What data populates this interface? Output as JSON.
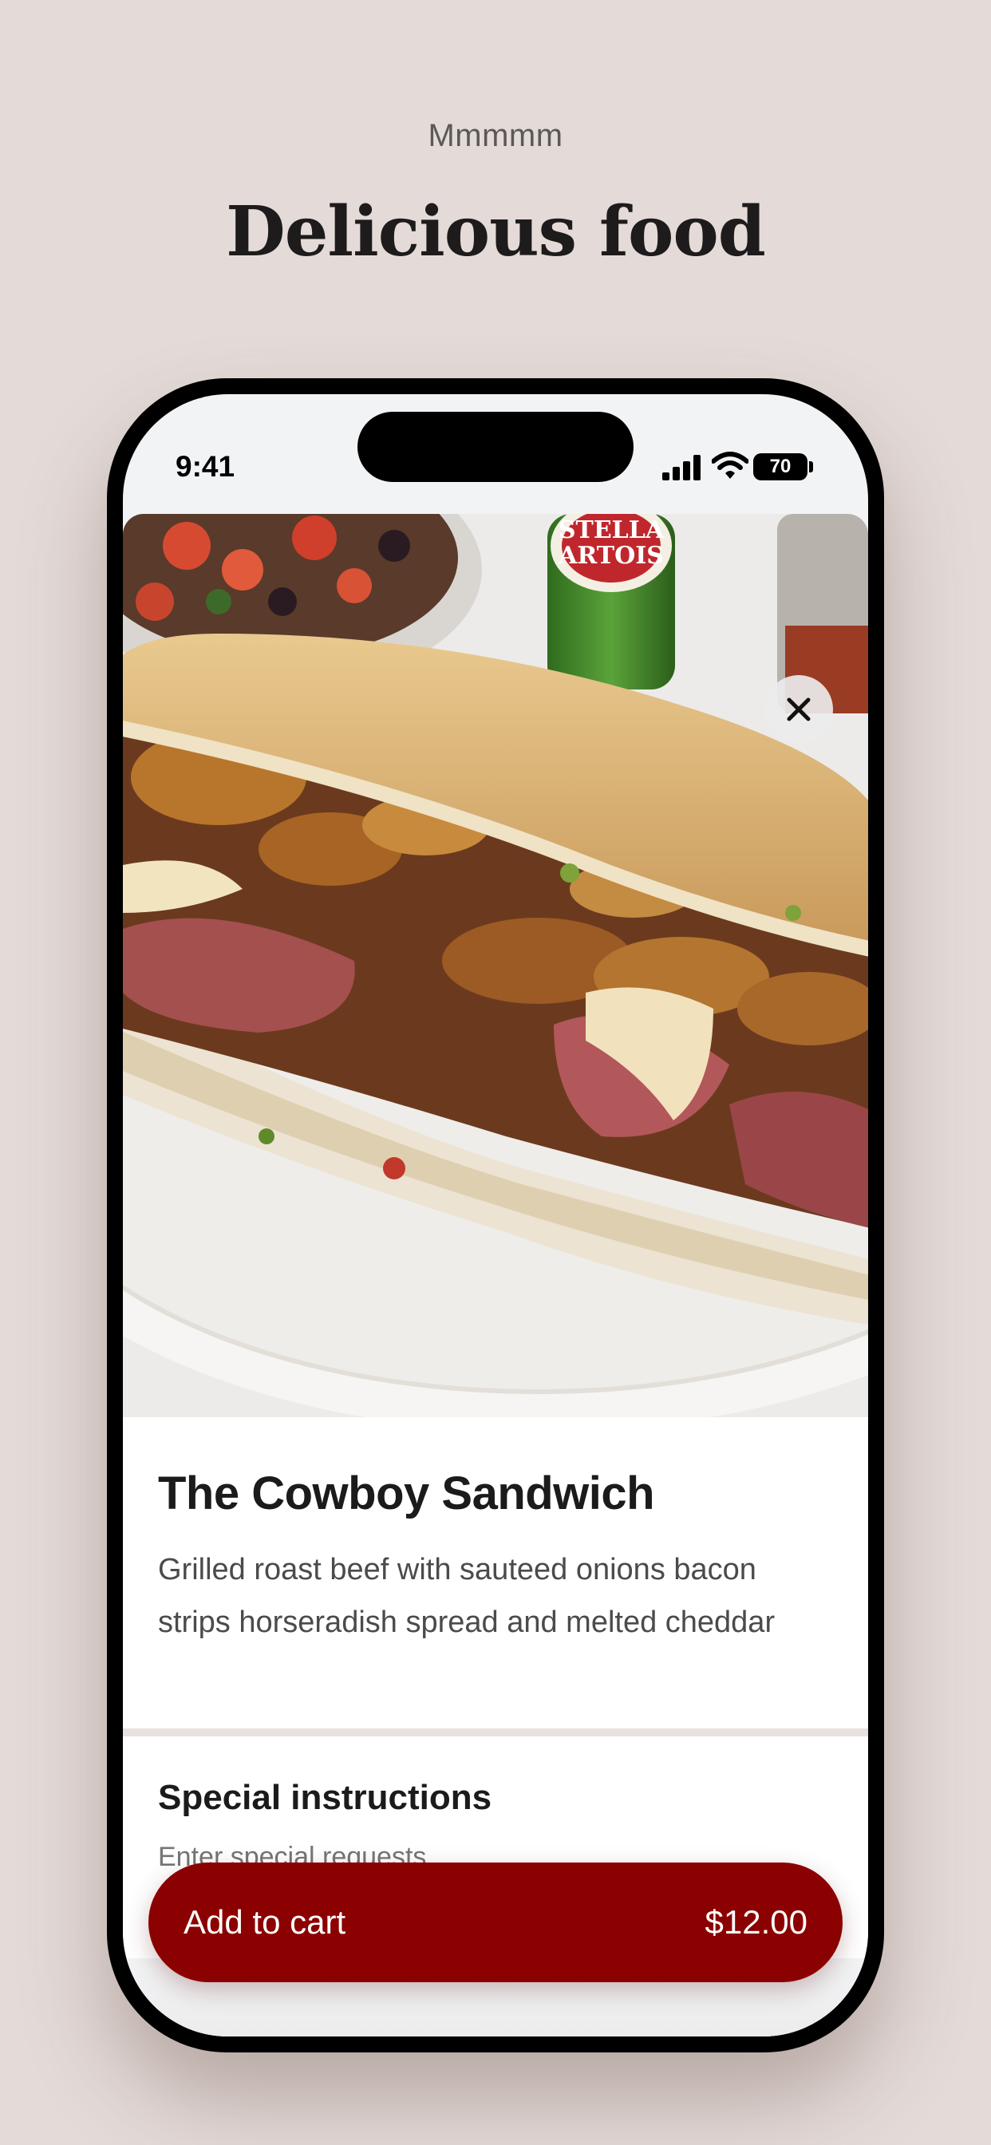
{
  "header": {
    "eyebrow": "Mmmmm",
    "title": "Delicious food"
  },
  "status_bar": {
    "time": "9:41",
    "battery": "70"
  },
  "hero": {
    "close_icon": "close-icon",
    "beer_label_line1": "STELLA",
    "beer_label_line2": "ARTOIS"
  },
  "item": {
    "name": "The Cowboy Sandwich",
    "description": "Grilled roast beef with sauteed onions bacon strips horseradish spread and melted cheddar"
  },
  "special_instructions": {
    "title": "Special instructions",
    "placeholder": "Enter special requests"
  },
  "cart": {
    "label": "Add to cart",
    "price": "$12.00"
  },
  "colors": {
    "background": "#e4dbd8",
    "accent": "#8b0000",
    "divider": "#e9e1de"
  }
}
